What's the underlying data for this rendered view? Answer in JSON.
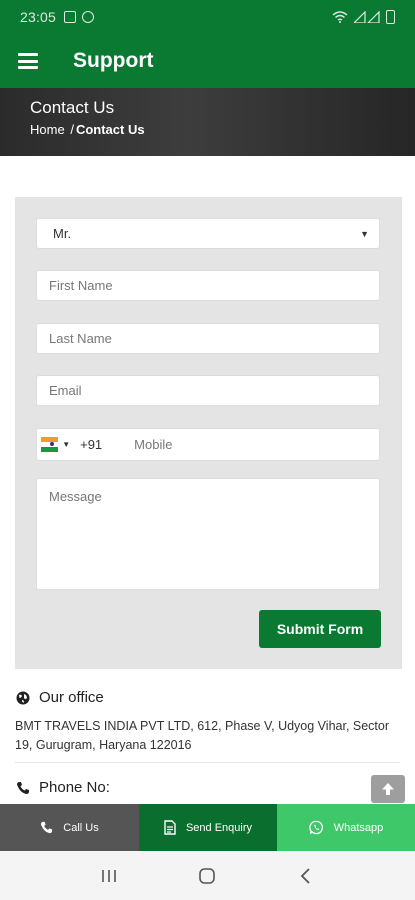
{
  "status_bar": {
    "time": "23:05"
  },
  "app_bar": {
    "title": "Support",
    "menu_icon": "hamburger-menu-icon"
  },
  "banner": {
    "title": "Contact Us",
    "breadcrumb_home": "Home",
    "breadcrumb_separator": "/",
    "breadcrumb_current": "Contact Us"
  },
  "form": {
    "salutation": {
      "selected": "Mr."
    },
    "first_name": {
      "placeholder": "First Name"
    },
    "last_name": {
      "placeholder": "Last Name"
    },
    "email": {
      "placeholder": "Email"
    },
    "phone": {
      "country_flag": "india-flag-icon",
      "dial_code": "+91",
      "placeholder": "Mobile"
    },
    "message": {
      "placeholder": "Message"
    },
    "submit_label": "Submit Form"
  },
  "office": {
    "heading": "Our office",
    "address": "BMT TRAVELS INDIA PVT LTD, 612, Phase V, Udyog Vihar, Sector 19, Gurugram, Haryana 122016"
  },
  "phone_section": {
    "heading": "Phone No:"
  },
  "actions": [
    {
      "label": "Call Us",
      "icon": "phone-icon",
      "color": "#555555"
    },
    {
      "label": "Send Enquiry",
      "icon": "document-icon",
      "color": "#0a6f2e"
    },
    {
      "label": "Whatsapp",
      "icon": "whatsapp-icon",
      "color": "#3fc86a"
    }
  ],
  "colors": {
    "primary": "#0a7a33",
    "panel": "#e4e4e4",
    "whatsapp": "#3fc86a"
  }
}
